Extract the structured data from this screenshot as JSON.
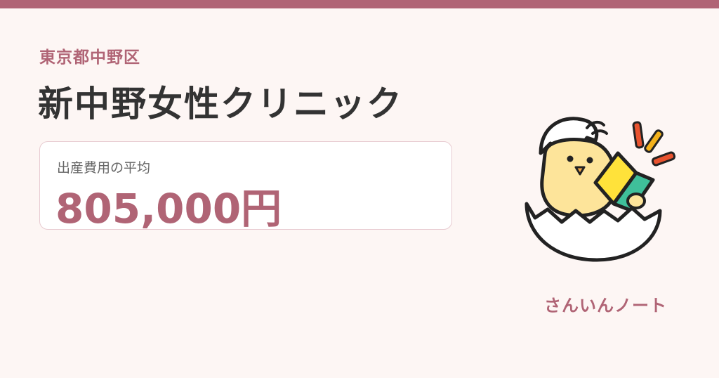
{
  "header": {
    "region": "東京都中野区",
    "clinic_name": "新中野女性クリニック"
  },
  "price_card": {
    "label": "出産費用の平均",
    "value": "805,000円"
  },
  "brand": {
    "name": "さんいんノート"
  },
  "colors": {
    "accent": "#b06475",
    "background": "#fdf6f4",
    "title_text": "#333333",
    "card_border": "#e8cbd1"
  },
  "mascot": {
    "icon": "chick-in-eggshell-reading-book-icon"
  }
}
